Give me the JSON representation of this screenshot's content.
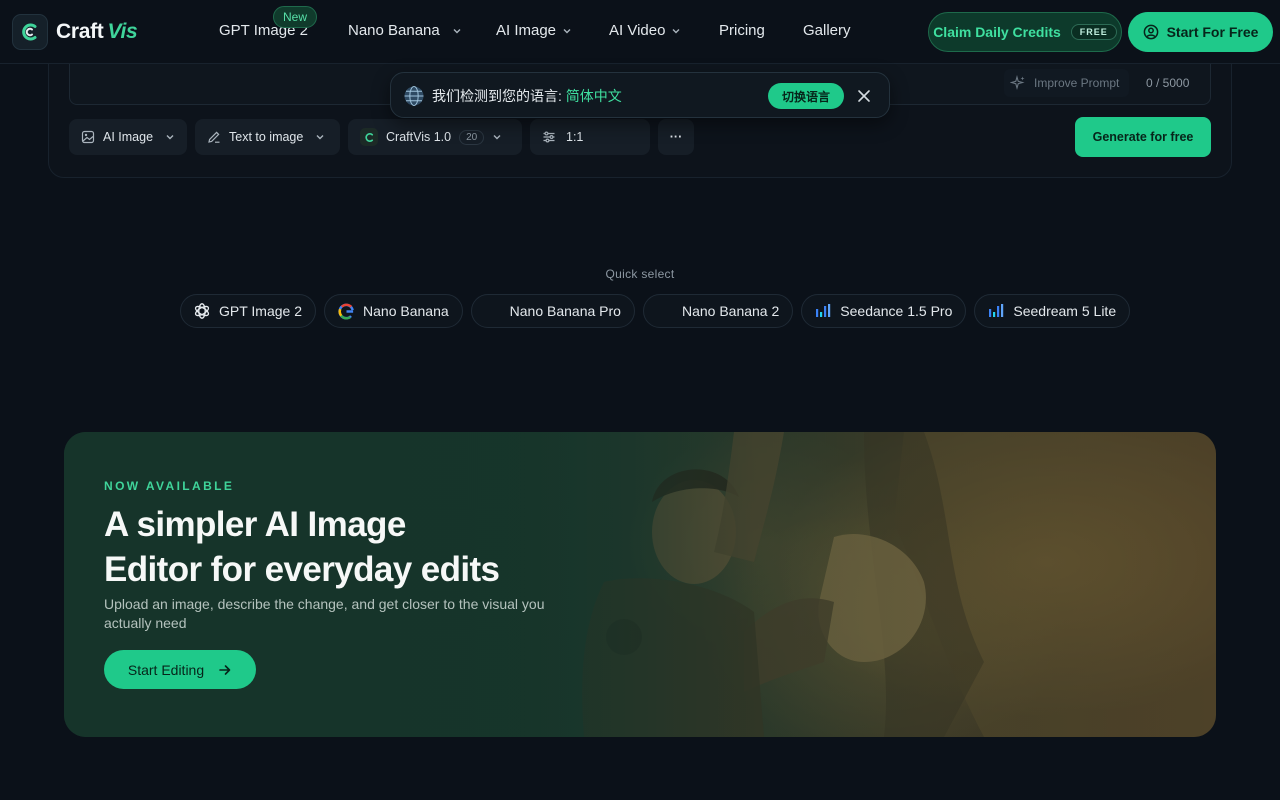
{
  "brand": {
    "name_main": "Craft",
    "name_accent": "Vis"
  },
  "nav": {
    "items": [
      {
        "label": "GPT Image 2",
        "badge": "New"
      },
      {
        "label": "Nano Banana"
      },
      {
        "label": "AI Image"
      },
      {
        "label": "AI Video"
      },
      {
        "label": "Pricing"
      },
      {
        "label": "Gallery"
      }
    ],
    "claim_label": "Claim Daily Credits",
    "claim_badge": "FREE",
    "start_label": "Start For Free"
  },
  "editor": {
    "improve_label": "Improve Prompt",
    "counter": "0 / 5000",
    "type_select": "AI Image",
    "mode_select": "Text to image",
    "model_select": "CraftVis 1.0",
    "model_cost": "20",
    "ratio": "1:1",
    "more_label": "···",
    "generate_label": "Generate for free"
  },
  "language_popup": {
    "message": "我们检测到您的语言: ",
    "language": "简体中文",
    "switch_label": "切换语言"
  },
  "quick_select": {
    "label": "Quick select",
    "chips": [
      {
        "label": "GPT Image 2",
        "icon": "openai-icon"
      },
      {
        "label": "Nano Banana",
        "icon": "google-icon"
      },
      {
        "label": "Nano Banana Pro",
        "icon": "banana-moon-icon"
      },
      {
        "label": "Nano Banana 2",
        "icon": "banana-moon-icon"
      },
      {
        "label": "Seedance 1.5 Pro",
        "icon": "bars-icon"
      },
      {
        "label": "Seedream 5 Lite",
        "icon": "bars-icon"
      }
    ]
  },
  "hero": {
    "eyebrow": "NOW AVAILABLE",
    "title_line1": "A simpler AI Image",
    "title_line2": "Editor for everyday edits",
    "subtitle": "Upload an image, describe the change, and get closer to the visual you actually need",
    "cta_label": "Start Editing"
  },
  "colors": {
    "accent": "#1fc98a",
    "accent_text": "#3fd49a",
    "background": "#0b1119"
  }
}
